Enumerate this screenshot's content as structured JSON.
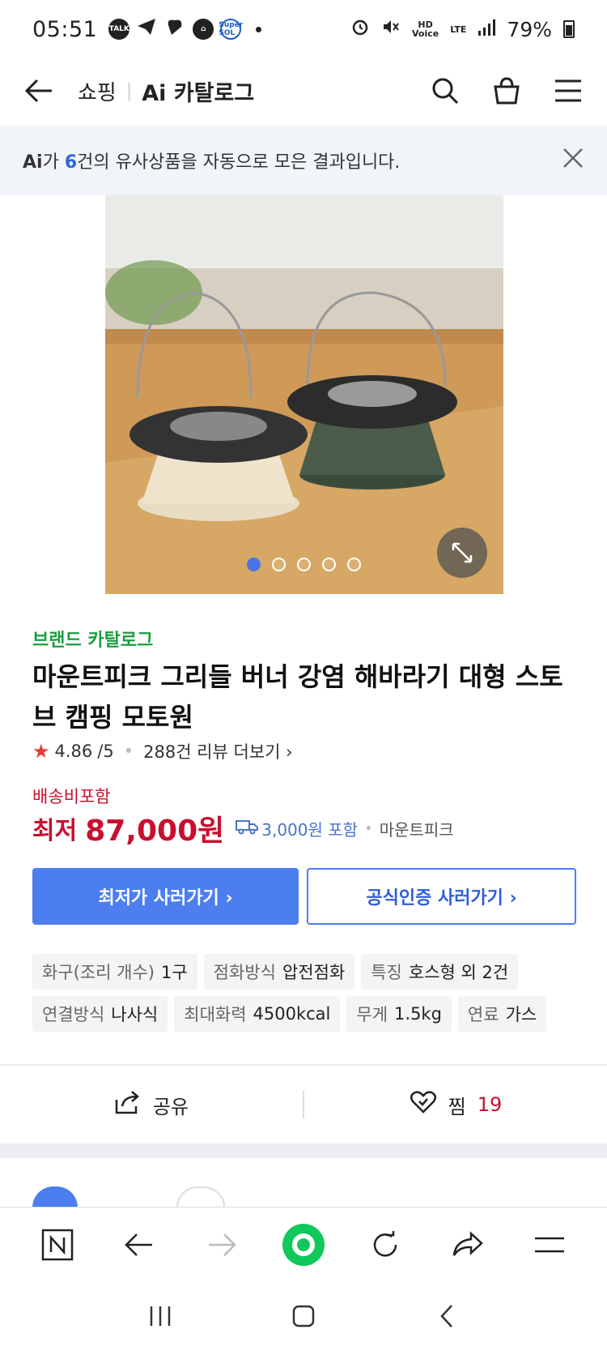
{
  "status_bar": {
    "time": "05:51",
    "battery": "79%",
    "left_icons": [
      "TALK",
      "Super SOL"
    ],
    "hd_label": "HD\nVoice",
    "lte_label": "LTE"
  },
  "header": {
    "shopping": "쇼핑",
    "catalog": "Ai 카탈로그"
  },
  "banner": {
    "ai": "Ai",
    "prefix": "가 ",
    "count": "6",
    "suffix": "건의 유사상품을 자동으로 모은 결과입니다."
  },
  "product": {
    "brand_catalog": "브랜드 카탈로그",
    "title": "마운트피크 그리들 버너 강염 해바라기 대형 스토브 캠핑 모토원",
    "rating": "4.86",
    "rating_max": "/5",
    "reviews": "288건 리뷰 더보기",
    "shipping_included_label": "배송비포함",
    "lowest_label": "최저",
    "price": "87,000원",
    "shipping_fee": "3,000원 포함",
    "seller": "마운트피크",
    "image_count": 5,
    "active_image": 1
  },
  "buttons": {
    "lowest_buy": "최저가 사러가기 ›",
    "official_buy": "공식인증 사러가기 ›"
  },
  "specs": [
    {
      "key": "화구(조리 개수)",
      "value": "1구"
    },
    {
      "key": "점화방식",
      "value": "압전점화"
    },
    {
      "key": "특징",
      "value": "호스형 외 2건"
    },
    {
      "key": "연결방식",
      "value": "나사식"
    },
    {
      "key": "최대화력",
      "value": "4500kcal"
    },
    {
      "key": "무게",
      "value": "1.5kg"
    },
    {
      "key": "연료",
      "value": "가스"
    }
  ],
  "actions": {
    "share": "공유",
    "wish": "찜",
    "wish_count": "19"
  },
  "colors": {
    "accent_blue": "#4d7ef0",
    "price_red": "#c8102e",
    "brand_green": "#1a9e3f"
  }
}
